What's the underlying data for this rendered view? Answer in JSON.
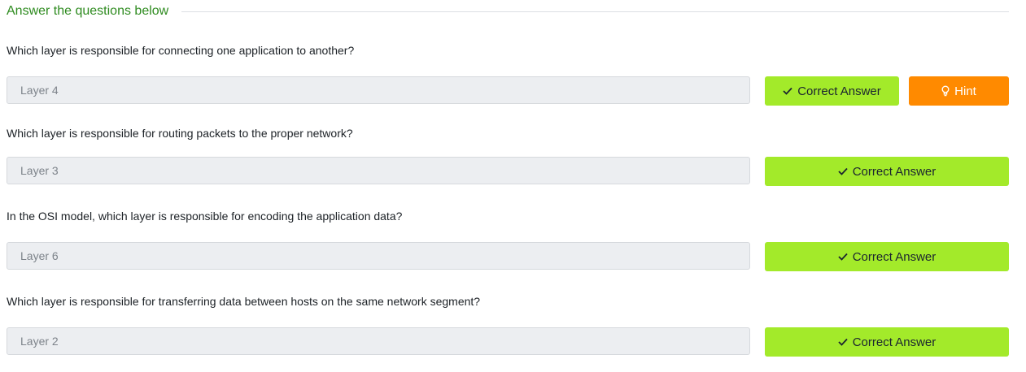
{
  "section": {
    "title": "Answer the questions below"
  },
  "questions": [
    {
      "text": "Which layer is responsible for connecting one application to another?",
      "answer": "Layer 4",
      "correct_label": "Correct Answer",
      "hint_label": "Hint"
    },
    {
      "text": "Which layer is responsible for routing packets to the proper network?",
      "answer": "Layer 3",
      "correct_label": "Correct Answer"
    },
    {
      "text": "In the OSI model, which layer is responsible for encoding the application data?",
      "answer": "Layer 6",
      "correct_label": "Correct Answer"
    },
    {
      "text": "Which layer is responsible for transferring data between hosts on the same network segment?",
      "answer": "Layer 2",
      "correct_label": "Correct Answer"
    }
  ],
  "icons": {
    "correct": "check-icon",
    "hint": "lightbulb-icon"
  },
  "colors": {
    "section_title": "#2e8b1f",
    "correct_button": "#a3ea2a",
    "hint_button": "#ff8a00",
    "input_background": "#eceef1"
  }
}
